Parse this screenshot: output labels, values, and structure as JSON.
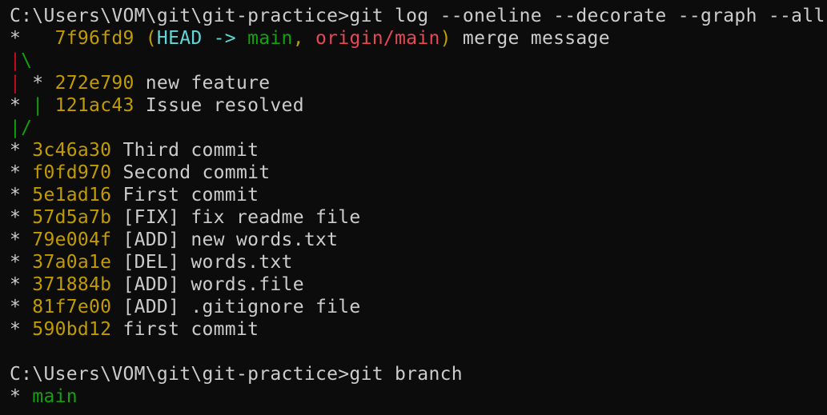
{
  "terminal": {
    "prompt1": "C:\\Users\\VOM\\git\\git-practice>",
    "command1": "git log --oneline --decorate --graph --all",
    "merge_commit": {
      "graph": "*   ",
      "hash": "7f96fd9",
      "open_paren": " (",
      "head": "HEAD -> ",
      "branch_main": "main",
      "comma": ", ",
      "remote": "origin/main",
      "close_paren": ")",
      "message": " merge message"
    },
    "graph_fork": {
      "bar": "|",
      "backslash": "\\"
    },
    "feature_commit": {
      "bar": "|",
      "star": " * ",
      "hash": "272e790",
      "message": " new feature"
    },
    "issue_commit": {
      "star": "* ",
      "bar": "|",
      "hash": " 121ac43",
      "message": " Issue resolved"
    },
    "graph_join": {
      "bar": "|",
      "slash": "/"
    },
    "commits": [
      {
        "hash": "3c46a30",
        "message": "Third commit"
      },
      {
        "hash": "f0fd970",
        "message": "Second commit"
      },
      {
        "hash": "5e1ad16",
        "message": "First commit"
      },
      {
        "hash": "57d5a7b",
        "message": "[FIX] fix readme file"
      },
      {
        "hash": "79e004f",
        "message": "[ADD] new words.txt"
      },
      {
        "hash": "37a0a1e",
        "message": "[DEL] words.txt"
      },
      {
        "hash": "371884b",
        "message": "[ADD] words.file"
      },
      {
        "hash": "81f7e00",
        "message": "[ADD] .gitignore file"
      },
      {
        "hash": "590bd12",
        "message": "first commit"
      }
    ],
    "commit_star": "* ",
    "prompt2": "C:\\Users\\VOM\\git\\git-practice>",
    "command2": "git branch",
    "branch_line": {
      "star": "* ",
      "name": "main"
    }
  },
  "colors": {
    "background": "#0c0c0c",
    "text": "#cccccc",
    "hash": "#c19c00",
    "head": "#61d6d6",
    "local_branch": "#13a10e",
    "remote_branch": "#e74856",
    "graph_red": "#c50f1f",
    "graph_green": "#13a10e"
  }
}
